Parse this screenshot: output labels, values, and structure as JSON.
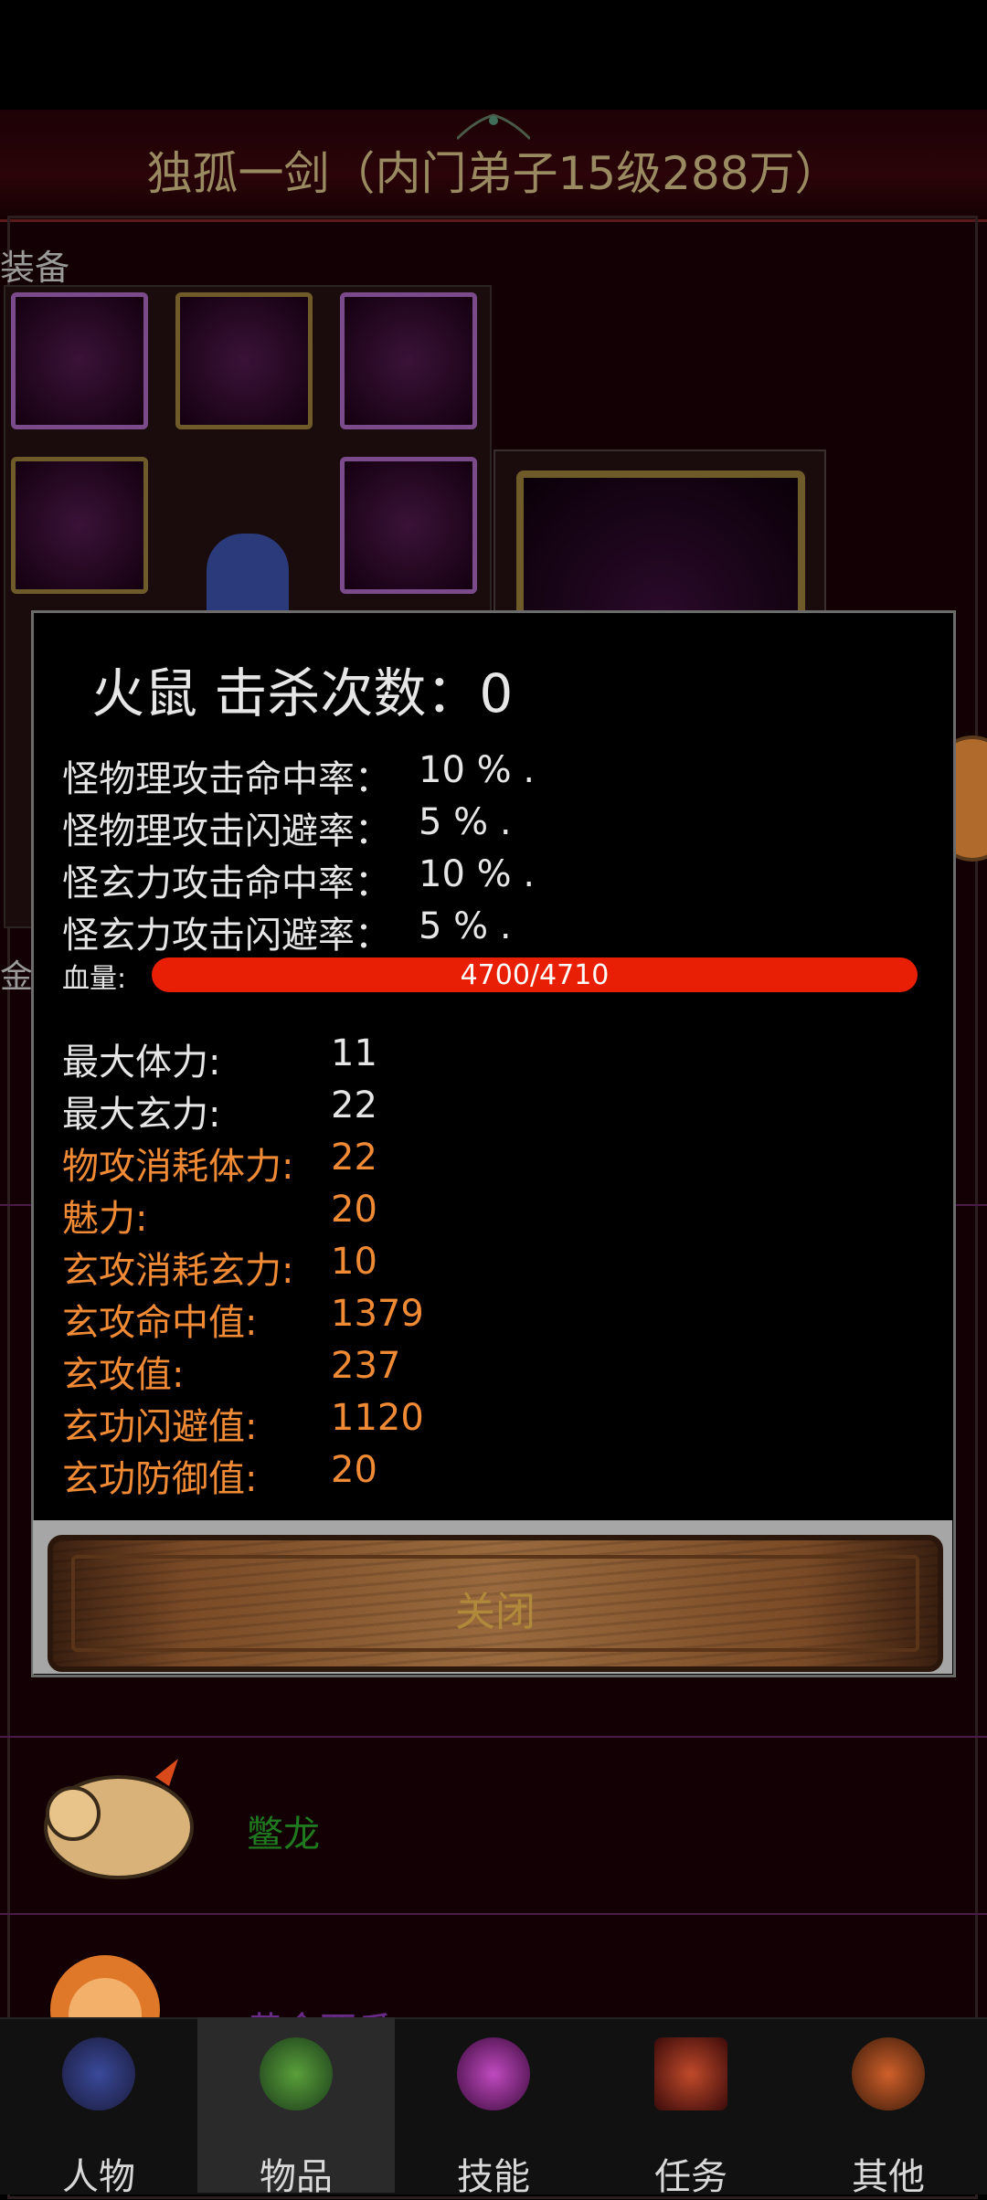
{
  "header": {
    "title": "独孤一剑（内门弟子15级288万）"
  },
  "background": {
    "equip_label": "装备",
    "gold_label": "金币",
    "pet_rows": [
      {
        "name": "鳖龙"
      },
      {
        "name": "黄金西瓜"
      }
    ]
  },
  "popup": {
    "title": "火鼠  击杀次数：0",
    "rates": [
      {
        "label": "怪物理攻击命中率：",
        "value": "10 % ."
      },
      {
        "label": "怪物理攻击闪避率：",
        "value": "5 % ."
      },
      {
        "label": "怪玄力攻击命中率：",
        "value": "10 % ."
      },
      {
        "label": "怪玄力攻击闪避率：",
        "value": "5 % ."
      }
    ],
    "hp": {
      "label": "血量:",
      "text": "4700/4710",
      "current": 4700,
      "max": 4710
    },
    "attributes": [
      {
        "label": "最大体力:",
        "value": "11",
        "color": "white"
      },
      {
        "label": "最大玄力:",
        "value": "22",
        "color": "white"
      },
      {
        "label": "物攻消耗体力:",
        "value": "22",
        "color": "orange"
      },
      {
        "label": "魅力:",
        "value": "20",
        "color": "orange"
      },
      {
        "label": "玄攻消耗玄力:",
        "value": "10",
        "color": "orange"
      },
      {
        "label": "玄攻命中值:",
        "value": "1379",
        "color": "orange"
      },
      {
        "label": "玄攻值:",
        "value": "237",
        "color": "orange"
      },
      {
        "label": "玄功闪避值:",
        "value": "1120",
        "color": "orange"
      },
      {
        "label": "玄功防御值:",
        "value": "20",
        "color": "orange"
      }
    ],
    "close_label": "关闭"
  },
  "nav": {
    "tabs": [
      {
        "label": "人物",
        "icon": "character-icon"
      },
      {
        "label": "物品",
        "icon": "potion-bag-icon",
        "active": true
      },
      {
        "label": "技能",
        "icon": "skill-swirl-icon"
      },
      {
        "label": "任务",
        "icon": "quest-flag-icon"
      },
      {
        "label": "其他",
        "icon": "crossed-swords-icon"
      }
    ]
  },
  "colors": {
    "hp_bar": "#e81f05",
    "orange_text": "#f18a34",
    "title_text": "#9a8a62"
  }
}
